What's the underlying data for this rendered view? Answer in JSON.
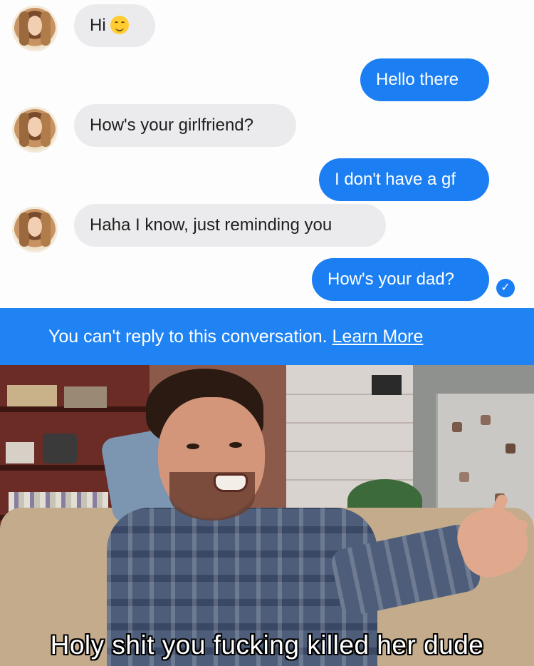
{
  "conversation": {
    "messages": [
      {
        "sender": "contact",
        "text": "Hi",
        "emoji": "smiling-face-icon"
      },
      {
        "sender": "me",
        "text": "Hello there"
      },
      {
        "sender": "contact",
        "text": "How's your girlfriend?"
      },
      {
        "sender": "me",
        "text": "I don't have a gf"
      },
      {
        "sender": "contact",
        "text": "Haha I know, just reminding you"
      },
      {
        "sender": "me",
        "text": "How's your dad?",
        "status_icon": "seen-check-icon"
      }
    ],
    "colors": {
      "incoming_bubble": "#ebebed",
      "outgoing_bubble": "#1b7ef2",
      "banner": "#1f83f4"
    }
  },
  "banner": {
    "message": "You can't reply to this conversation.",
    "link": "Learn More"
  },
  "meme": {
    "caption": "Holy shit you fucking killed her dude"
  }
}
